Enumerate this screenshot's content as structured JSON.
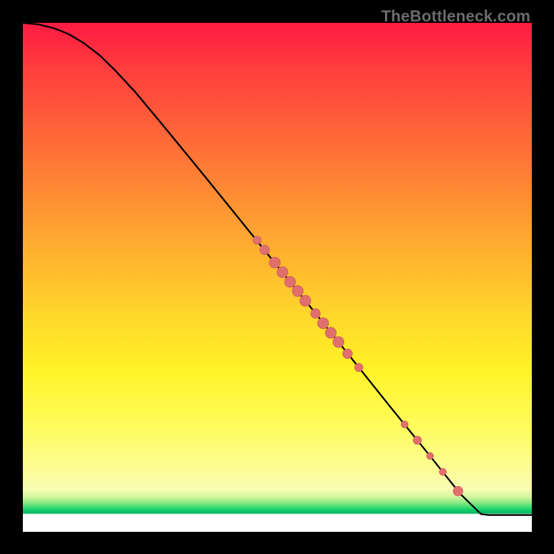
{
  "watermark": "TheBottleneck.com",
  "colors": {
    "dot_fill": "#e16f6e",
    "dot_stroke": "#c45a59",
    "curve": "#000000",
    "frame_bg": "#000000"
  },
  "chart_data": {
    "type": "line",
    "title": "",
    "xlabel": "",
    "ylabel": "",
    "xlim": [
      0,
      100
    ],
    "ylim": [
      0,
      100
    ],
    "curve": [
      {
        "x": 0,
        "y": 100.0
      },
      {
        "x": 3,
        "y": 99.7
      },
      {
        "x": 6,
        "y": 99.0
      },
      {
        "x": 9,
        "y": 97.8
      },
      {
        "x": 12,
        "y": 96.0
      },
      {
        "x": 15,
        "y": 93.7
      },
      {
        "x": 18,
        "y": 90.8
      },
      {
        "x": 22,
        "y": 86.5
      },
      {
        "x": 27,
        "y": 80.5
      },
      {
        "x": 33,
        "y": 73.2
      },
      {
        "x": 40,
        "y": 64.6
      },
      {
        "x": 48,
        "y": 54.7
      },
      {
        "x": 56,
        "y": 44.8
      },
      {
        "x": 64,
        "y": 34.8
      },
      {
        "x": 72,
        "y": 24.8
      },
      {
        "x": 80,
        "y": 14.9
      },
      {
        "x": 86,
        "y": 7.4
      },
      {
        "x": 90,
        "y": 3.5
      },
      {
        "x": 91.5,
        "y": 3.3
      },
      {
        "x": 100,
        "y": 3.3
      }
    ],
    "series": [
      {
        "name": "highlighted-points",
        "points": [
          {
            "x": 46.0,
            "y": 57.3,
            "r": 6
          },
          {
            "x": 47.5,
            "y": 55.4,
            "r": 7
          },
          {
            "x": 49.5,
            "y": 52.9,
            "r": 8
          },
          {
            "x": 51.0,
            "y": 51.0,
            "r": 8
          },
          {
            "x": 52.5,
            "y": 49.1,
            "r": 8
          },
          {
            "x": 54.0,
            "y": 47.3,
            "r": 8
          },
          {
            "x": 55.5,
            "y": 45.4,
            "r": 8
          },
          {
            "x": 57.5,
            "y": 42.9,
            "r": 7
          },
          {
            "x": 59.0,
            "y": 41.0,
            "r": 8
          },
          {
            "x": 60.5,
            "y": 39.1,
            "r": 8
          },
          {
            "x": 62.0,
            "y": 37.3,
            "r": 8
          },
          {
            "x": 63.8,
            "y": 35.0,
            "r": 7
          },
          {
            "x": 66.0,
            "y": 32.3,
            "r": 6
          },
          {
            "x": 75.0,
            "y": 21.1,
            "r": 5
          },
          {
            "x": 77.5,
            "y": 18.0,
            "r": 6
          },
          {
            "x": 80.0,
            "y": 14.9,
            "r": 5
          },
          {
            "x": 82.5,
            "y": 11.8,
            "r": 5
          },
          {
            "x": 85.5,
            "y": 8.0,
            "r": 7
          }
        ]
      }
    ]
  }
}
